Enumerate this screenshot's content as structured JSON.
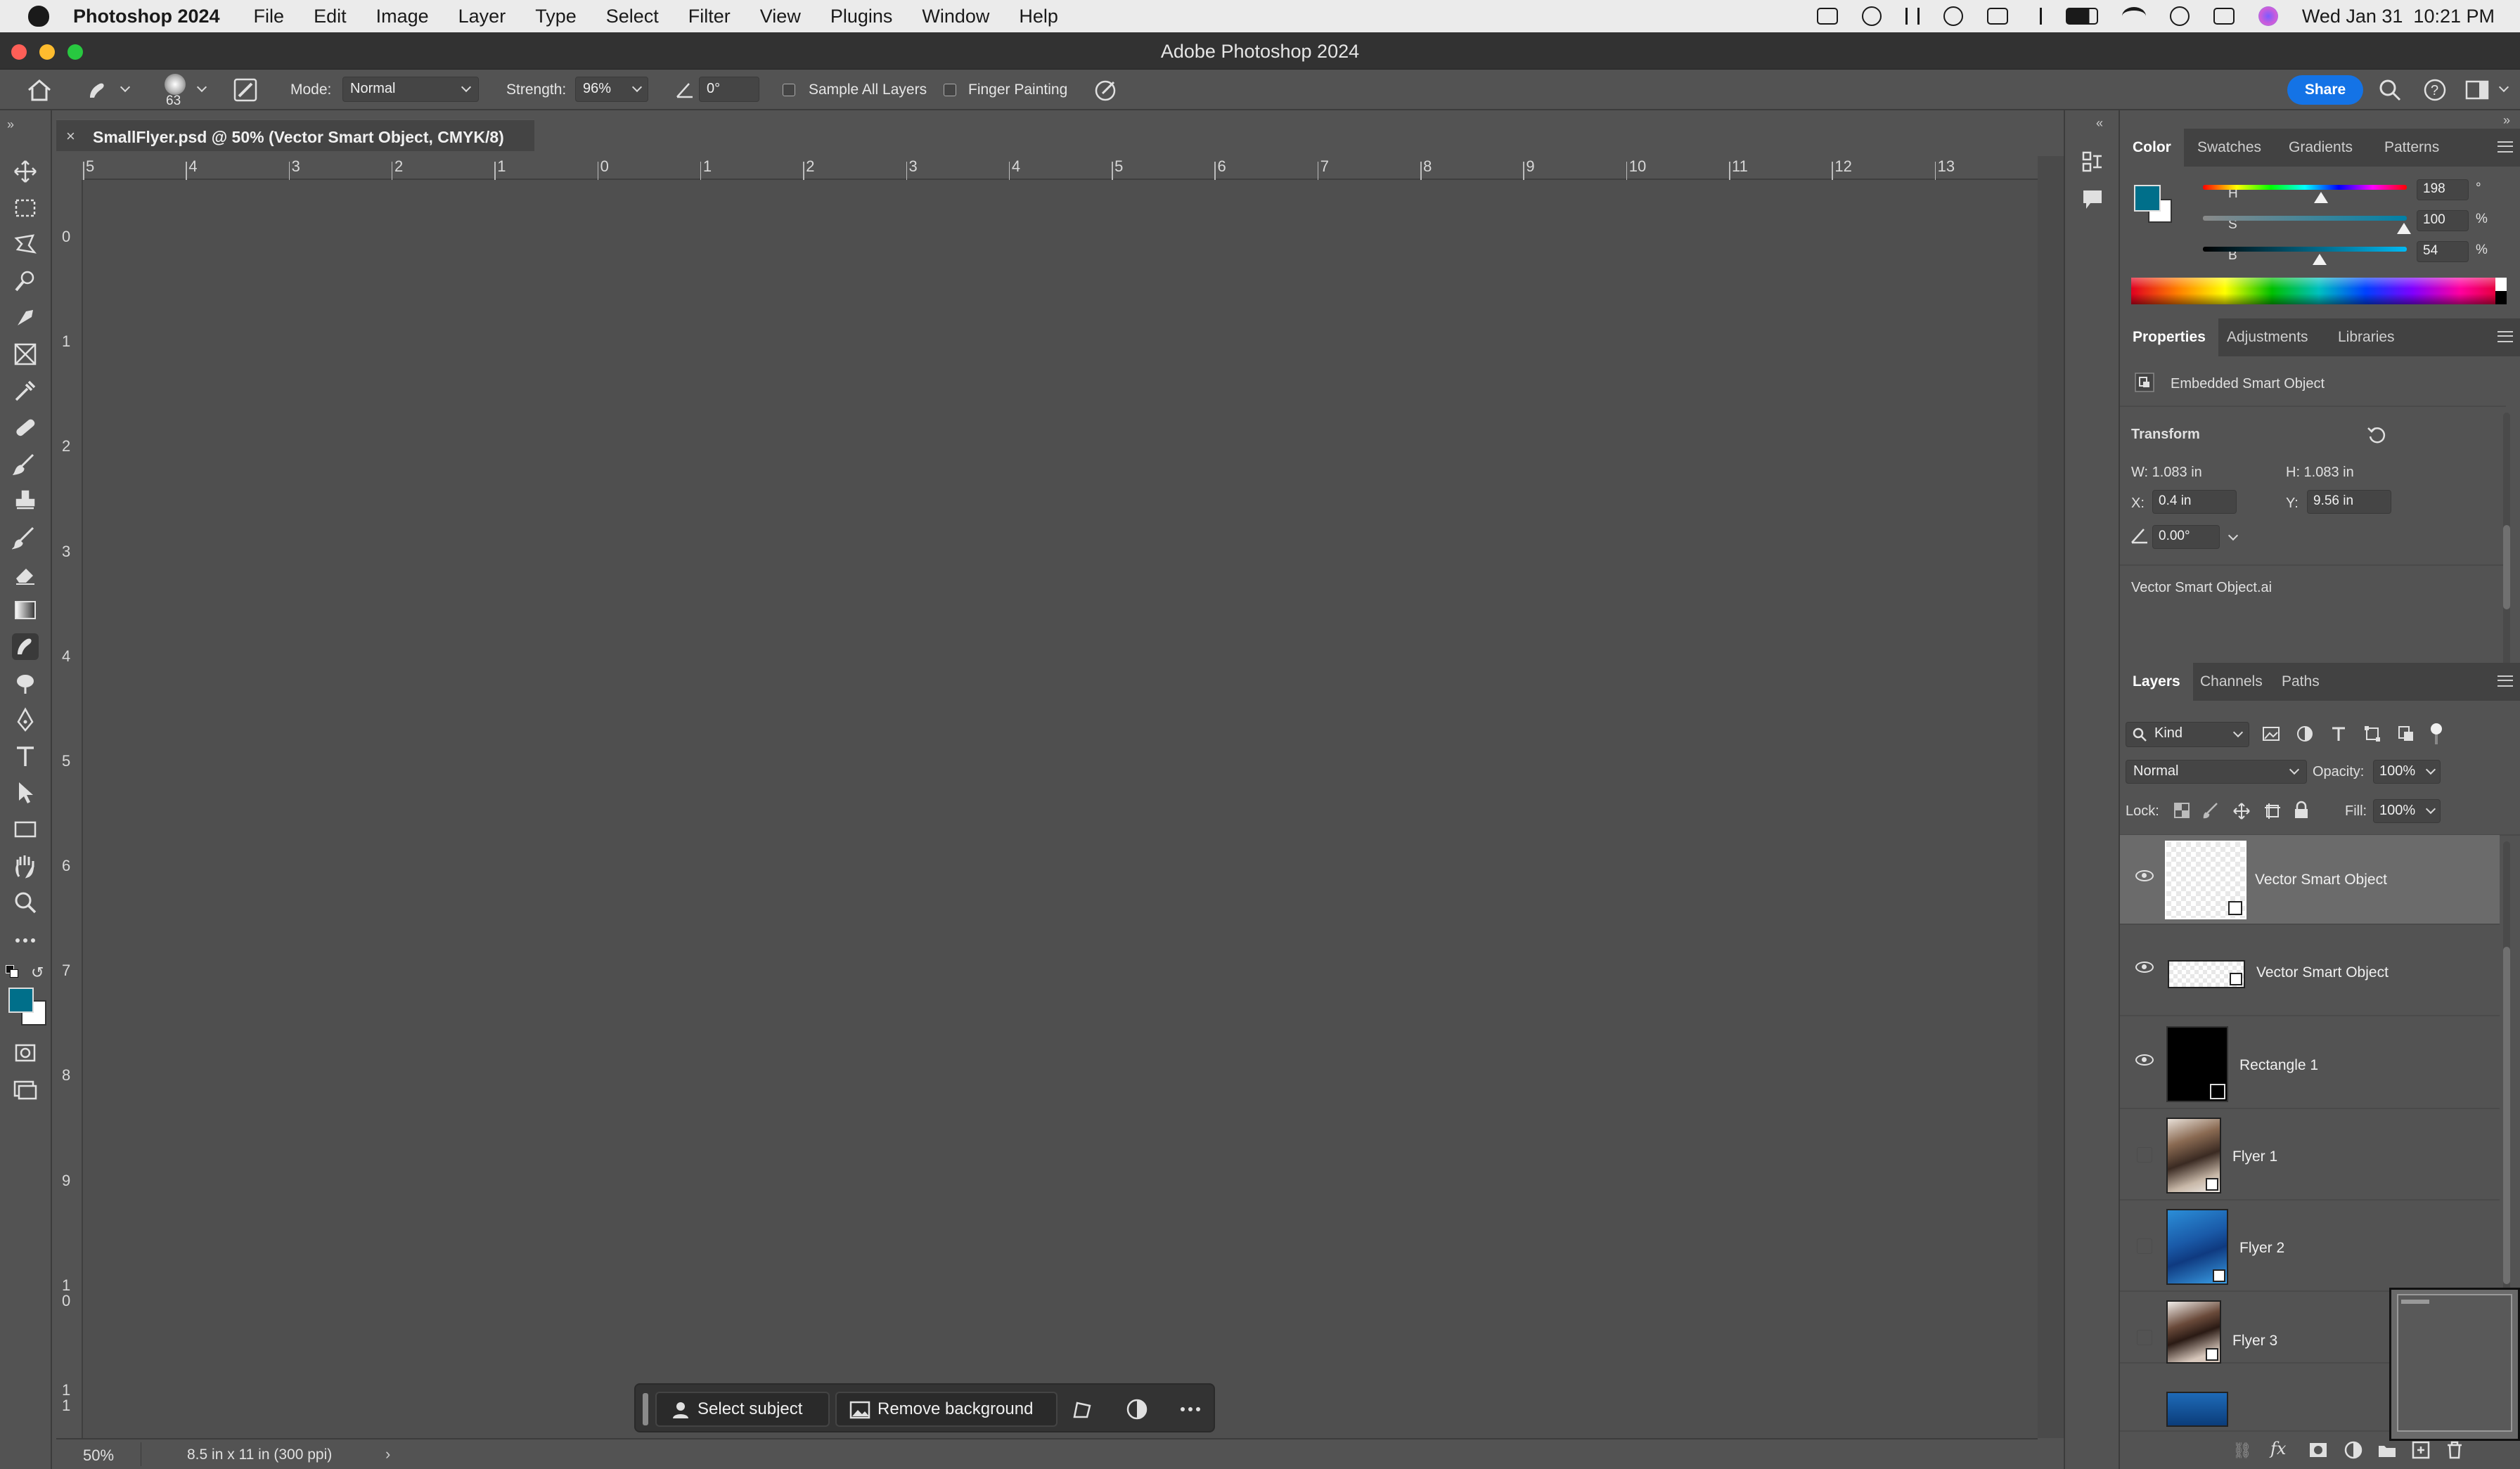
{
  "menubar": {
    "app_name": "Photoshop 2024",
    "items": [
      "File",
      "Edit",
      "Image",
      "Layer",
      "Type",
      "Select",
      "Filter",
      "View",
      "Plugins",
      "Window",
      "Help"
    ],
    "datetime": "Wed Jan 31  10:21 PM"
  },
  "window": {
    "title": "Adobe Photoshop 2024"
  },
  "options": {
    "brush_size": "63",
    "mode_label": "Mode:",
    "mode_value": "Normal",
    "strength_label": "Strength:",
    "strength_value": "96%",
    "angle_value": "0°",
    "sample_all_layers": "Sample All Layers",
    "finger_painting": "Finger Painting",
    "share": "Share"
  },
  "document": {
    "tab_title": "SmallFlyer.psd @ 50% (Vector Smart Object, CMYK/8)",
    "hruler": [
      "5",
      "4",
      "3",
      "2",
      "1",
      "0",
      "1",
      "2",
      "3",
      "4",
      "5",
      "6",
      "7",
      "8",
      "9",
      "10",
      "11",
      "12",
      "13"
    ],
    "vruler": [
      "0",
      "1",
      "2",
      "3",
      "4",
      "5",
      "6",
      "7",
      "8",
      "9",
      "1\n0",
      "1\n1"
    ]
  },
  "status": {
    "zoom": "50%",
    "doc_info": "8.5 in x 11 in (300 ppi)"
  },
  "contextual": {
    "select_subject": "Select subject",
    "remove_background": "Remove background"
  },
  "color_panel": {
    "tabs": [
      "Color",
      "Swatches",
      "Gradients",
      "Patterns"
    ],
    "h_label": "H",
    "h_value": "198",
    "h_unit": "°",
    "s_label": "S",
    "s_value": "100",
    "s_unit": "%",
    "b_label": "B",
    "b_value": "54",
    "b_unit": "%",
    "foreground": "#006f8a"
  },
  "properties_panel": {
    "tabs": [
      "Properties",
      "Adjustments",
      "Libraries"
    ],
    "object_type": "Embedded Smart Object",
    "transform_label": "Transform",
    "w": "W: 1.083 in",
    "h": "H: 1.083 in",
    "x_label": "X:",
    "x_value": "0.4 in",
    "y_label": "Y:",
    "y_value": "9.56 in",
    "angle": "0.00°",
    "source_file": "Vector Smart Object.ai"
  },
  "layers_panel": {
    "tabs": [
      "Layers",
      "Channels",
      "Paths"
    ],
    "kind": "Kind",
    "blend_mode": "Normal",
    "opacity_label": "Opacity:",
    "opacity_value": "100%",
    "lock_label": "Lock:",
    "fill_label": "Fill:",
    "fill_value": "100%",
    "layers": [
      {
        "name": "Vector Smart Object",
        "visible": true,
        "selected": true
      },
      {
        "name": "Vector Smart Object",
        "visible": true,
        "selected": false
      },
      {
        "name": "Rectangle 1",
        "visible": true,
        "selected": false
      },
      {
        "name": "Flyer 1",
        "visible": false,
        "selected": false
      },
      {
        "name": "Flyer 2",
        "visible": false,
        "selected": false
      },
      {
        "name": "Flyer 3",
        "visible": false,
        "selected": false
      }
    ]
  }
}
